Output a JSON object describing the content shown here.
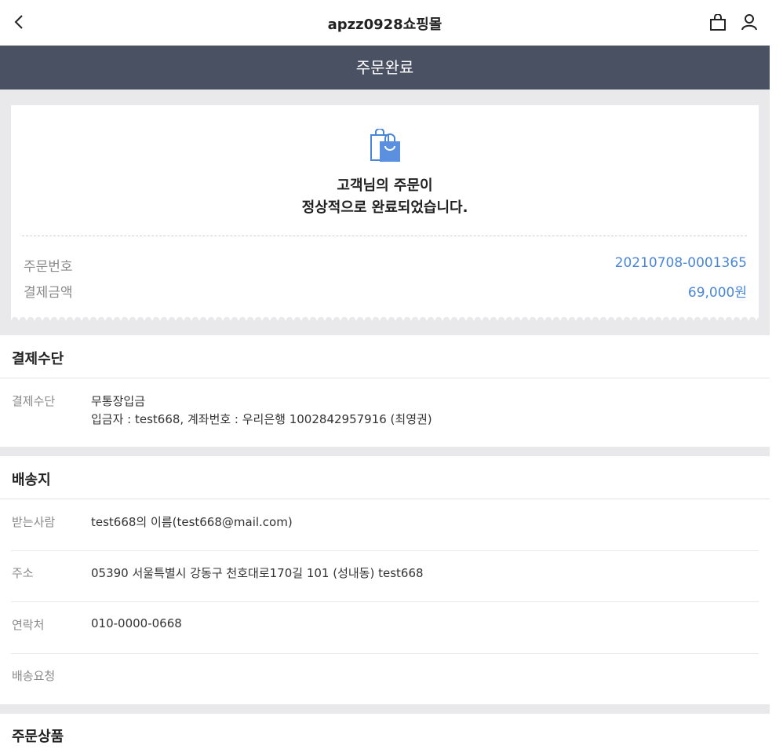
{
  "header": {
    "shop_name": "apzz0928쇼핑몰",
    "page_title": "주문완료"
  },
  "receipt": {
    "message_line1": "고객님의 주문이",
    "message_line2": "정상적으로 완료되었습니다.",
    "order_number_label": "주문번호",
    "order_number": "20210708-0001365",
    "amount_label": "결제금액",
    "amount": "69,000원",
    "accent_color": "#4a86d8"
  },
  "payment": {
    "section_title": "결제수단",
    "method_label": "결제수단",
    "method": "무통장입금",
    "detail": "입금자 : test668, 계좌번호 : 우리은행 1002842957916 (최영권)"
  },
  "shipping": {
    "section_title": "배송지",
    "recipient_label": "받는사람",
    "recipient": "test668의 이름(test668@mail.com)",
    "address_label": "주소",
    "address": "05390 서울특별시 강동구 천호대로170길 101 (성내동) test668",
    "phone_label": "연락처",
    "phone": "010-0000-0668",
    "request_label": "배송요청",
    "request": ""
  },
  "items": {
    "section_title": "주문상품"
  },
  "icons": {
    "back": "chevron-left-icon",
    "cart": "shopping-bag-icon",
    "user": "user-icon",
    "order_complete": "shopping-bag-check-icon"
  },
  "colors": {
    "title_bar": "#4a5163",
    "background": "#e9e9ec"
  }
}
